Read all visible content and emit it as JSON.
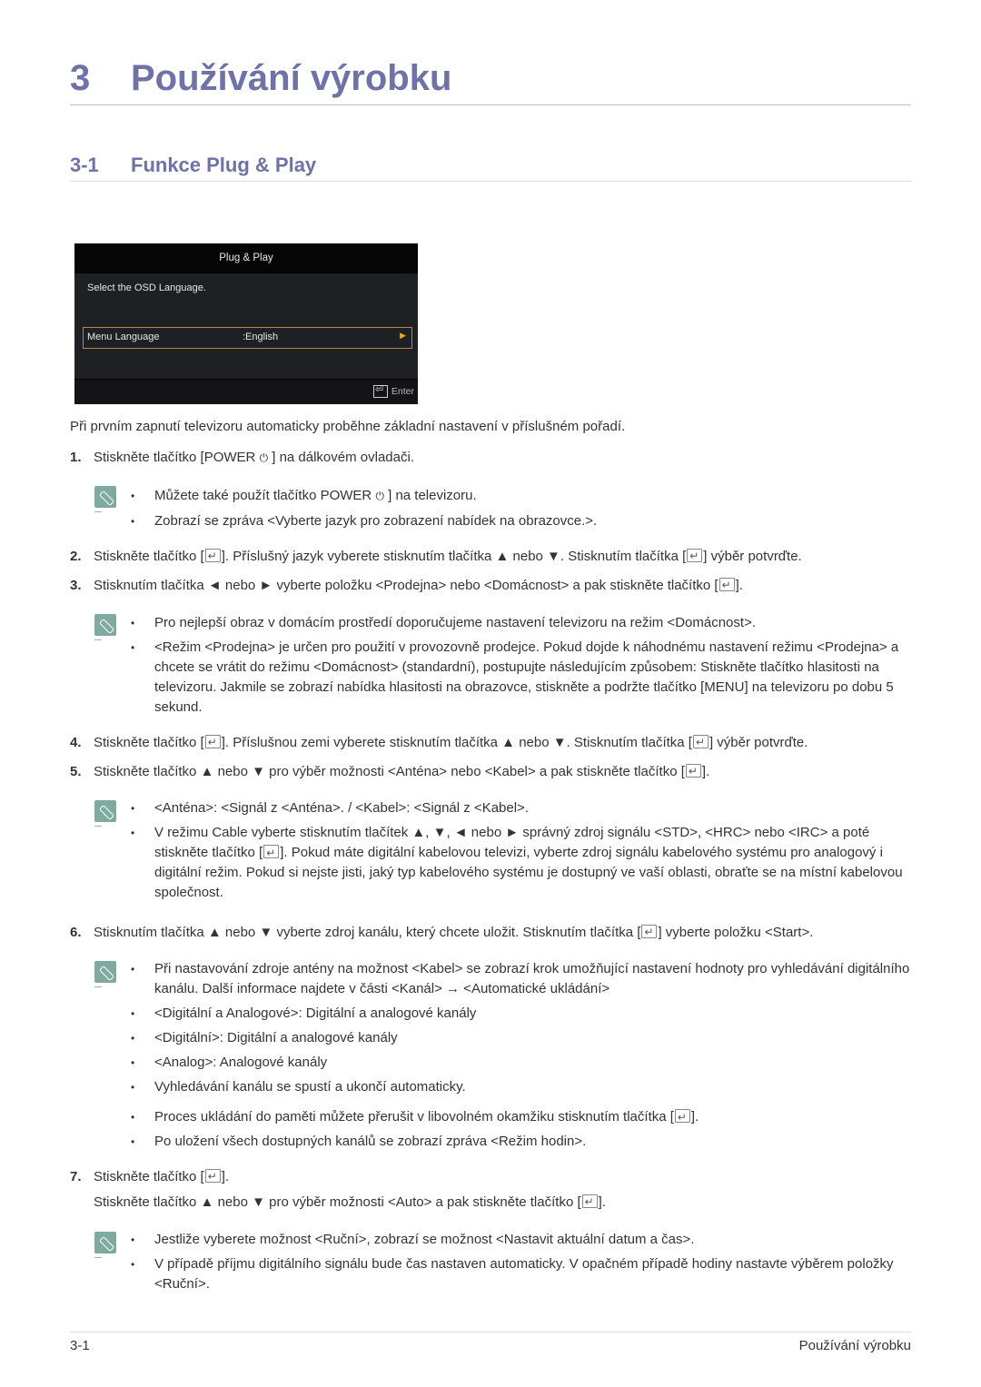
{
  "chapter": {
    "number": "3",
    "title": "Používání výrobku"
  },
  "section": {
    "number": "3-1",
    "title": "Funkce Plug & Play"
  },
  "osd": {
    "header": "Plug & Play",
    "subtitle": "Select the OSD Language.",
    "row_label": "Menu Language",
    "row_value": ":English",
    "row_arrow": "▶",
    "enter_label": "Enter",
    "border_color": "#b08a3e",
    "arrow_color": "#e8a823"
  },
  "intro": "Při prvním zapnutí televizoru automaticky proběhne základní nastavení v příslušném pořadí.",
  "steps": [
    {
      "n": "1.",
      "parts": [
        "Stiskněte tlačítko [POWER ",
        " ] na dálkovém ovladači."
      ]
    },
    {
      "n": "2.",
      "parts": [
        "Stiskněte tlačítko [",
        "]. Příslušný jazyk vyberete stisknutím tlačítka ▲ nebo ▼. Stisknutím tlačítka [",
        "] výběr potvrďte."
      ]
    },
    {
      "n": "3.",
      "parts": [
        "Stisknutím tlačítka ◄ nebo ► vyberte položku <Prodejna> nebo <Domácnost> a pak stiskněte tlačítko [",
        "]."
      ]
    },
    {
      "n": "4.",
      "parts": [
        "Stiskněte tlačítko [",
        "]. Příslušnou zemi vyberete stisknutím tlačítka ▲ nebo ▼. Stisknutím tlačítka [",
        "] výběr potvrďte."
      ]
    },
    {
      "n": "5.",
      "parts": [
        "Stiskněte tlačítko ▲ nebo ▼ pro výběr možnosti <Anténa> nebo <Kabel> a pak stiskněte tlačítko [",
        "]."
      ]
    },
    {
      "n": "6.",
      "parts": [
        "Stisknutím tlačítka ▲ nebo ▼ vyberte zdroj kanálu, který chcete uložit. Stisknutím tlačítka [",
        "] vyberte položku <Start>."
      ]
    },
    {
      "n": "7.",
      "parts": [
        "Stiskněte tlačítko [",
        "]."
      ]
    }
  ],
  "step7_cont": [
    "Stiskněte tlačítko ▲ nebo ▼ pro výběr možnosti <Auto> a pak stiskněte tlačítko [",
    "]."
  ],
  "notes": {
    "n1": [
      [
        "Můžete také použít tlačítko POWER ",
        " ] na televizoru."
      ],
      [
        "Zobrazí se zpráva <Vyberte jazyk pro zobrazení nabídek na obrazovce.>."
      ]
    ],
    "n3": [
      "Pro nejlepší obraz v domácím prostředí doporučujeme nastavení televizoru na režim <Domácnost>.",
      "<Režim <Prodejna> je určen pro použití v provozovně prodejce. Pokud dojde k náhodnému nastavení režimu <Prodejna> a chcete se vrátit do režimu <Domácnost> (standardní), postupujte následujícím způsobem: Stiskněte tlačítko hlasitosti na televizoru. Jakmile se zobrazí nabídka hlasitosti na obrazovce, stiskněte a podržte tlačítko [MENU] na televizoru po dobu 5 sekund."
    ],
    "n5": [
      [
        "<Anténa>: <Signál z <Anténa>. / <Kabel>: <Signál z <Kabel>."
      ],
      [
        "V režimu Cable vyberte stisknutím tlačítek ▲, ▼, ◄ nebo ► správný zdroj signálu <STD>, <HRC> nebo <IRC> a poté stiskněte tlačítko [",
        "]. Pokud máte digitální kabelovou televizi, vyberte zdroj signálu kabelového systému pro analogový i digitální režim. Pokud si nejste jisti, jaký typ kabelového systému je dostupný ve vaší oblasti, obraťte se na místní kabelovou společnost."
      ]
    ],
    "n6": [
      [
        "Při nastavování zdroje antény na možnost <Kabel> se zobrazí krok umožňující nastavení hodnoty pro vyhledávání digitálního kanálu. Další informace najdete v části <Kanál> → <Automatické ukládání>"
      ],
      [
        "<Digitální a Analogové>: Digitální a analogové kanály"
      ],
      [
        "<Digitální>: Digitální a analogové kanály"
      ],
      [
        "<Analog>: Analogové kanály"
      ],
      [
        "Vyhledávání kanálu se spustí a ukončí automaticky."
      ],
      [
        "Proces ukládání do paměti můžete přerušit v libovolném okamžiku stisknutím tlačítka [",
        "]."
      ],
      [
        "Po uložení všech dostupných kanálů se zobrazí zpráva <Režim hodin>."
      ]
    ],
    "n7": [
      "Jestliže vyberete možnost <Ruční>, zobrazí se možnost <Nastavit aktuální datum a čas>.",
      "V případě příjmu digitálního signálu bude čas nastaven automaticky. V opačném případě hodiny nastavte výběrem položky <Ruční>."
    ]
  },
  "icons": {
    "power": "⏻",
    "bullet": "•",
    "note": "note-pencil-icon",
    "enter": "enter-key-icon"
  },
  "footer": {
    "page": "3-1",
    "chapter": "Používání výrobku"
  },
  "colors": {
    "heading": "#6e72a8",
    "note_icon": "#7faa9e"
  }
}
